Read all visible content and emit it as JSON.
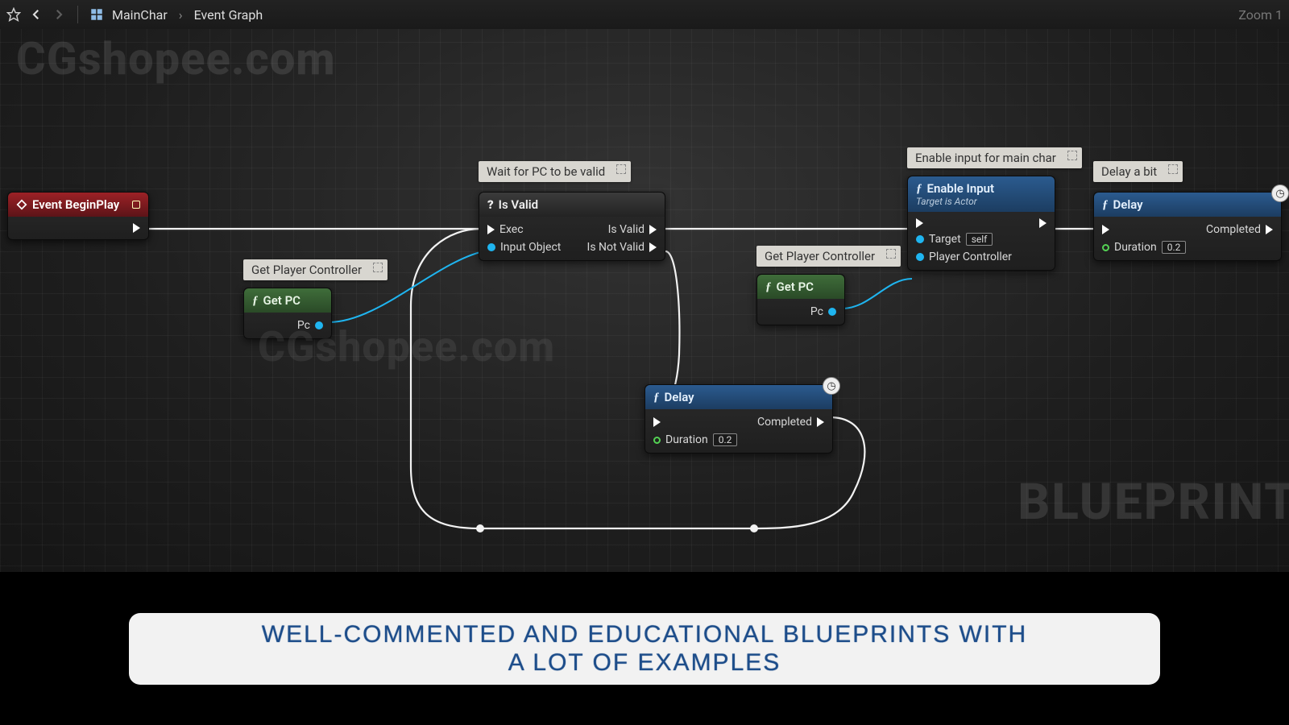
{
  "toolbar": {
    "crumb_root": "MainChar",
    "crumb_leaf": "Event Graph",
    "zoom_label": "Zoom 1"
  },
  "watermarks": {
    "top": "CGshopee.com",
    "mid": "CGshopee.com",
    "bp": "BLUEPRINT"
  },
  "comments": {
    "c1": "Wait for PC to be valid",
    "c2": "Get Player Controller",
    "c3": "Get Player Controller",
    "c4": "Enable input for main char",
    "c5": "Delay a bit"
  },
  "nodes": {
    "event_beginplay": {
      "title": "Event BeginPlay"
    },
    "isvalid": {
      "title": "Is Valid",
      "exec_in": "Exec",
      "input_object": "Input Object",
      "out_valid": "Is Valid",
      "out_notvalid": "Is Not Valid"
    },
    "getpc1": {
      "title": "Get PC",
      "out": "Pc"
    },
    "getpc2": {
      "title": "Get PC",
      "out": "Pc"
    },
    "delay1": {
      "title": "Delay",
      "completed": "Completed",
      "duration_label": "Duration",
      "duration_value": "0.2"
    },
    "enable_input": {
      "title": "Enable Input",
      "subtitle": "Target is Actor",
      "target_label": "Target",
      "target_value": "self",
      "pc_label": "Player Controller"
    },
    "delay2": {
      "title": "Delay",
      "completed": "Completed",
      "duration_label": "Duration",
      "duration_value": "0.2"
    }
  },
  "banner": {
    "line1": "WELL-COMMENTED AND EDUCATIONAL BLUEPRINTS WITH",
    "line2": "A LOT OF EXAMPLES"
  }
}
